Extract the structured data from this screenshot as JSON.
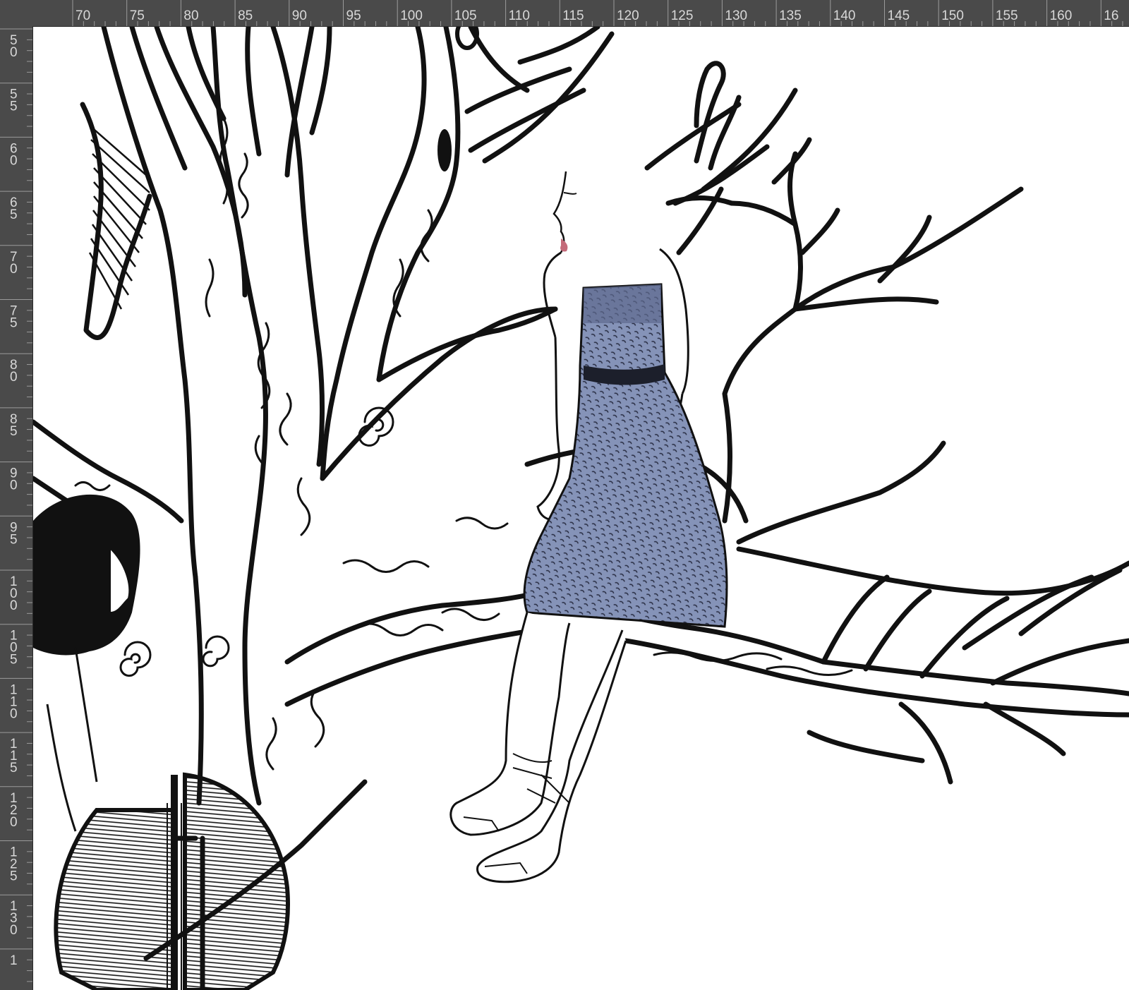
{
  "rulers": {
    "top": [
      "70",
      "75",
      "80",
      "85",
      "90",
      "95",
      "100",
      "105",
      "110",
      "115",
      "120",
      "125",
      "130",
      "135",
      "140",
      "145",
      "150",
      "155",
      "160",
      "16"
    ],
    "left": [
      "50",
      "55",
      "60",
      "65",
      "70",
      "75",
      "80",
      "85",
      "90",
      "95",
      "100",
      "105",
      "110",
      "115",
      "120",
      "125",
      "130",
      "1"
    ]
  },
  "canvas": {
    "background": "#ffffff",
    "ink_color": "#111111",
    "dress_color": "#7f8fb5",
    "lip_color": "#c46b7a"
  }
}
